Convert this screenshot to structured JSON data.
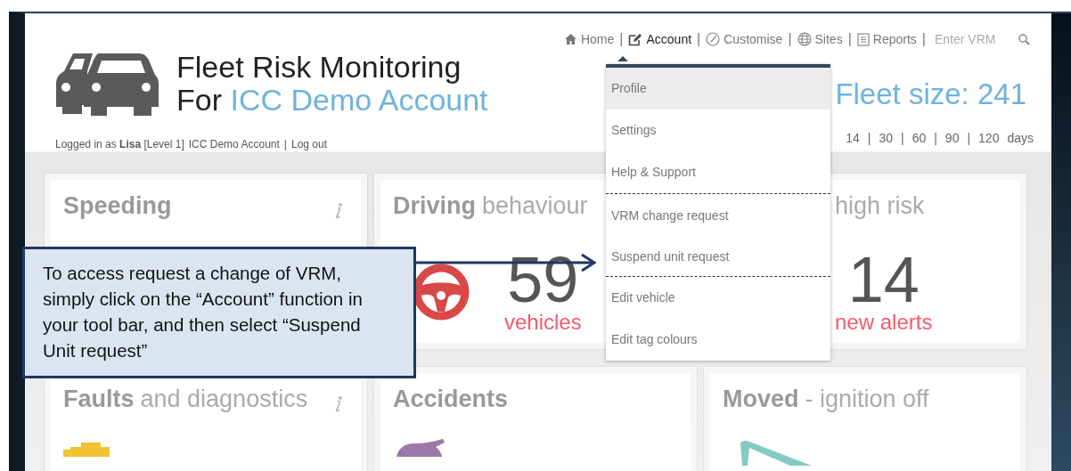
{
  "nav": {
    "items": [
      {
        "label": "Home",
        "selected": false,
        "separator": "|"
      },
      {
        "label": "Account",
        "selected": true,
        "separator": "|"
      },
      {
        "label": "Customise",
        "selected": false,
        "separator": "|"
      },
      {
        "label": "Sites",
        "selected": false,
        "separator": "|"
      },
      {
        "label": "Reports",
        "selected": false,
        "separator": "|"
      }
    ],
    "search": {
      "placeholder": "Enter VRM"
    }
  },
  "header": {
    "title": "Fleet Risk Monitoring",
    "subtitle_prefix": "For",
    "account_name": "ICC Demo Account",
    "login_text": "Logged in as **Lisa** [Level 1]",
    "account_link": "ICC Demo Account",
    "separator": "|",
    "logout": "Log out",
    "fleet_size": "Fleet size: 241",
    "periods": [
      {
        "label": "14",
        "separator": "|"
      },
      {
        "label": "30",
        "separator": "|"
      },
      {
        "label": "60",
        "separator": "|"
      },
      {
        "label": "90",
        "separator": "|"
      },
      {
        "label": "120"
      }
    ],
    "period_unit": "days"
  },
  "account_menu": {
    "sections": [
      {
        "items": [
          {
            "label": "Profile",
            "selected": true
          },
          {
            "label": "Settings",
            "selected": false
          },
          {
            "label": "Help & Support",
            "selected": false
          }
        ]
      },
      {
        "items": [
          {
            "label": "VRM change request",
            "selected": false
          },
          {
            "label": "Suspend unit request",
            "selected": false
          }
        ]
      },
      {
        "items": [
          {
            "label": "Edit vehicle",
            "selected": false
          },
          {
            "label": "Edit tag colours",
            "selected": false
          }
        ]
      }
    ]
  },
  "cards": [
    {
      "title": "Speeding",
      "info": true
    },
    {
      "title": "Driving",
      "subtitle": "behaviour",
      "value": "59",
      "unit": "vehicles"
    },
    {
      "subtitle": "high risk",
      "value": "14",
      "unit": "new alerts"
    },
    {
      "title": "Faults",
      "subtitle": "and diagnostics",
      "info": true
    },
    {
      "title": "Accidents"
    },
    {
      "title": "Moved",
      "subtitle": "- ignition off"
    }
  ],
  "callout": {
    "text": "To access request a change of VRM, simply click on the “Account” function in your tool bar, and then select “Suspend Unit request”"
  }
}
